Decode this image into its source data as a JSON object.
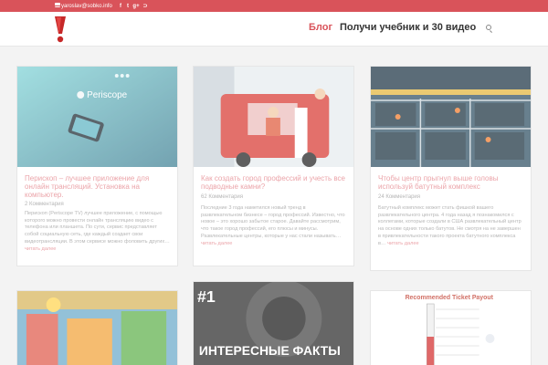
{
  "topbar": {
    "email": "yaroslav@sobko.info",
    "social_icons": [
      "envelope-icon",
      "facebook-icon",
      "twitter-icon",
      "google-plus-icon",
      "rss-icon"
    ],
    "twitter_glyph": "t",
    "facebook_glyph": "f",
    "gplus_glyph": "g+",
    "rss_glyph": "⊃"
  },
  "nav": {
    "blog": "Блог",
    "promo": "Получи учебник и 30 видео"
  },
  "posts": [
    {
      "title": "Перископ – лучшее приложение для онлайн трансляций. Установка на компьютер.",
      "comments": "2 Комментария",
      "excerpt": "Перископ (Periscope TV) лучшее приложение, с помощью которого можно провести онлайн трансляцию видео с телефона или планшета. По сути, сервис представляет собой социальную сеть, где каждый создает свои видеотрансляции. В этом сервисе можно фоловить других…",
      "more": "читать далее",
      "thumb_text": "Periscope"
    },
    {
      "title": "Как создать город профессий и учесть все подводные камни?",
      "comments": "62 Комментария",
      "excerpt": "Последние 3 года наметился новый тренд в развлекательном бизнесе – город профессий. Известно, что новое – это хорошо забытое старое. Давайте рассмотрим, что такое город профессий, его плюсы и минусы.  Развлекательные центры, которые у нас стали называть…",
      "more": "читать далее"
    },
    {
      "title": "Чтобы центр прыгнул выше головы используй батутный комплекс",
      "comments": "24 Комментария",
      "excerpt": "Батутный комплекс может стать фишкой вашего развлекательного центра. 4 года назад я познакомился с коллегами, которые создали в США развлекательный центр на основе одних только батутов. Не смотря на не завершен в привлекательности такого проекта батутного комплекса в…",
      "more": "читать далее"
    },
    {
      "title": "",
      "comments": "",
      "excerpt": "",
      "more": ""
    },
    {
      "thumb_line1": "#1",
      "thumb_line2": "ИНТЕРЕСНЫЕ ФАКТЫ"
    },
    {
      "thumb_caption": "Recommended Ticket Payout"
    }
  ],
  "colors": {
    "accent": "#d9535a",
    "title_link": "#e48188"
  }
}
